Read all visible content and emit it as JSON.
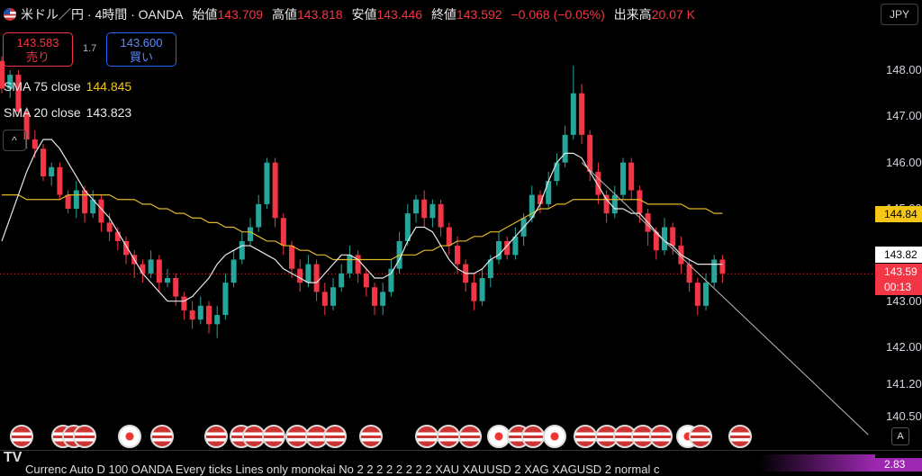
{
  "header": {
    "symbol": "米ドル／円 · 4時間 · OANDA",
    "open_label": "始値",
    "open": "143.709",
    "high_label": "高値",
    "high": "143.818",
    "low_label": "安値",
    "low": "143.446",
    "close_label": "終値",
    "close": "143.592",
    "change": "−0.068 (−0.05%)",
    "volume_label": "出来高",
    "volume": "20.07 K"
  },
  "trade": {
    "sell_price": "143.583",
    "sell_label": "売り",
    "spread": "1.7",
    "buy_price": "143.600",
    "buy_label": "買い"
  },
  "indicators": {
    "sma75_label": "SMA 75 close",
    "sma75_value": "144.845",
    "sma20_label": "SMA 20 close",
    "sma20_value": "143.823"
  },
  "currency_button": "JPY",
  "y_axis": {
    "ticks": [
      "148.00",
      "147.00",
      "146.00",
      "145.00",
      "144.00",
      "143.00",
      "142.00",
      "141.20",
      "140.50"
    ],
    "tag_sma75": "144.84",
    "tag_sma20": "143.82",
    "tag_price": "143.59",
    "tag_timer": "00:13",
    "tag_bottom": "2.83"
  },
  "bottom_bar": {
    "logo": "TV",
    "ticker_text": "Currenc     Auto D 100 OANDA Every ticks Lines only monokai No 2 2 2 2 2 2 2 2 XAU XAUUSD 2 XAG XAGUSD 2 normal c",
    "auto_button": "A"
  },
  "colors": {
    "up": "#26a69a",
    "down": "#f23645",
    "sma75": "#e0b726",
    "sma20": "#e8e8e8",
    "price_line": "#f23645"
  },
  "chart_data": {
    "type": "candlestick",
    "ylim": [
      140.5,
      148.3
    ],
    "candles": [
      [
        148.2,
        147.6,
        148.3,
        147.5
      ],
      [
        147.6,
        147.9,
        148.0,
        147.4
      ],
      [
        147.9,
        147.1,
        148.0,
        147.0
      ],
      [
        147.1,
        146.5,
        147.2,
        146.3
      ],
      [
        146.5,
        146.3,
        146.7,
        146.1
      ],
      [
        146.3,
        145.7,
        146.4,
        145.6
      ],
      [
        145.7,
        145.9,
        146.0,
        145.5
      ],
      [
        145.9,
        145.3,
        146.0,
        145.2
      ],
      [
        145.3,
        145.0,
        145.4,
        144.9
      ],
      [
        145.0,
        145.4,
        145.6,
        144.8
      ],
      [
        145.4,
        144.9,
        145.5,
        144.7
      ],
      [
        144.9,
        145.2,
        145.4,
        144.8
      ],
      [
        145.2,
        144.7,
        145.3,
        144.5
      ],
      [
        144.7,
        144.5,
        144.9,
        144.3
      ],
      [
        144.5,
        144.3,
        144.6,
        144.1
      ],
      [
        144.3,
        144.0,
        144.4,
        143.8
      ],
      [
        144.0,
        143.8,
        144.1,
        143.5
      ],
      [
        143.8,
        143.6,
        143.9,
        143.4
      ],
      [
        143.6,
        143.9,
        144.1,
        143.5
      ],
      [
        143.9,
        143.4,
        144.0,
        143.2
      ],
      [
        143.4,
        143.5,
        143.7,
        143.3
      ],
      [
        143.5,
        143.1,
        143.6,
        142.9
      ],
      [
        143.1,
        142.8,
        143.2,
        142.6
      ],
      [
        142.8,
        142.6,
        143.0,
        142.4
      ],
      [
        142.6,
        142.9,
        143.1,
        142.5
      ],
      [
        142.9,
        142.5,
        143.0,
        142.3
      ],
      [
        142.5,
        142.7,
        142.9,
        142.2
      ],
      [
        142.7,
        143.4,
        143.6,
        142.6
      ],
      [
        143.4,
        143.9,
        144.1,
        143.3
      ],
      [
        143.9,
        144.3,
        144.5,
        143.8
      ],
      [
        144.3,
        144.6,
        144.8,
        144.2
      ],
      [
        144.6,
        145.1,
        145.3,
        144.5
      ],
      [
        145.1,
        146.0,
        146.1,
        145.0
      ],
      [
        146.0,
        144.8,
        146.1,
        144.6
      ],
      [
        144.8,
        144.2,
        144.9,
        144.0
      ],
      [
        144.2,
        143.7,
        144.3,
        143.5
      ],
      [
        143.7,
        143.4,
        143.9,
        143.2
      ],
      [
        143.4,
        143.8,
        144.0,
        143.3
      ],
      [
        143.8,
        143.2,
        143.9,
        143.0
      ],
      [
        143.2,
        142.9,
        143.4,
        142.7
      ],
      [
        142.9,
        143.3,
        143.5,
        142.8
      ],
      [
        143.3,
        143.6,
        143.8,
        143.2
      ],
      [
        143.6,
        144.0,
        144.2,
        143.5
      ],
      [
        144.0,
        143.6,
        144.1,
        143.4
      ],
      [
        143.6,
        143.3,
        143.7,
        143.1
      ],
      [
        143.3,
        142.9,
        143.4,
        142.7
      ],
      [
        142.9,
        143.2,
        143.4,
        142.7
      ],
      [
        143.2,
        143.7,
        143.9,
        143.1
      ],
      [
        143.7,
        144.3,
        144.5,
        143.6
      ],
      [
        144.3,
        144.9,
        145.1,
        144.2
      ],
      [
        144.9,
        145.2,
        145.3,
        144.7
      ],
      [
        145.2,
        144.8,
        145.4,
        144.6
      ],
      [
        144.8,
        145.1,
        145.2,
        144.6
      ],
      [
        145.1,
        144.6,
        145.2,
        144.4
      ],
      [
        144.6,
        144.2,
        144.7,
        144.0
      ],
      [
        144.2,
        143.8,
        144.4,
        143.6
      ],
      [
        143.8,
        143.4,
        143.9,
        143.2
      ],
      [
        143.4,
        143.0,
        143.6,
        142.8
      ],
      [
        143.0,
        143.5,
        143.7,
        142.9
      ],
      [
        143.5,
        143.9,
        144.0,
        143.3
      ],
      [
        143.9,
        144.3,
        144.5,
        143.8
      ],
      [
        144.3,
        144.0,
        144.4,
        143.9
      ],
      [
        144.0,
        144.4,
        144.6,
        143.9
      ],
      [
        144.4,
        144.8,
        144.9,
        144.2
      ],
      [
        144.8,
        145.3,
        145.5,
        144.7
      ],
      [
        145.3,
        145.1,
        145.4,
        144.9
      ],
      [
        145.1,
        145.6,
        145.8,
        145.0
      ],
      [
        145.6,
        146.0,
        146.2,
        145.5
      ],
      [
        146.0,
        146.6,
        146.8,
        145.9
      ],
      [
        146.6,
        147.5,
        148.1,
        146.5
      ],
      [
        147.5,
        146.6,
        147.7,
        146.4
      ],
      [
        146.6,
        145.8,
        146.7,
        145.6
      ],
      [
        145.8,
        145.3,
        146.0,
        145.1
      ],
      [
        145.3,
        144.9,
        145.4,
        144.7
      ],
      [
        144.9,
        145.3,
        145.5,
        144.8
      ],
      [
        145.3,
        146.0,
        146.1,
        145.2
      ],
      [
        146.0,
        145.4,
        146.1,
        145.2
      ],
      [
        145.4,
        144.9,
        145.5,
        144.7
      ],
      [
        144.9,
        144.5,
        145.0,
        144.2
      ],
      [
        144.5,
        144.1,
        144.6,
        143.9
      ],
      [
        144.1,
        144.6,
        144.8,
        144.0
      ],
      [
        144.6,
        144.2,
        144.7,
        144.0
      ],
      [
        144.2,
        143.8,
        144.4,
        143.6
      ],
      [
        143.8,
        143.4,
        143.9,
        143.2
      ],
      [
        143.4,
        142.9,
        143.5,
        142.7
      ],
      [
        142.9,
        143.4,
        143.6,
        142.8
      ],
      [
        143.4,
        143.9,
        144.0,
        143.3
      ],
      [
        143.9,
        143.6,
        144.0,
        143.4
      ]
    ],
    "sma75": [
      145.3,
      145.3,
      145.3,
      145.2,
      145.2,
      145.2,
      145.2,
      145.2,
      145.3,
      145.3,
      145.3,
      145.3,
      145.3,
      145.3,
      145.2,
      145.2,
      145.2,
      145.1,
      145.1,
      145.0,
      145.0,
      144.9,
      144.9,
      144.8,
      144.8,
      144.7,
      144.7,
      144.6,
      144.6,
      144.5,
      144.5,
      144.4,
      144.3,
      144.3,
      144.2,
      144.2,
      144.1,
      144.1,
      144.0,
      144.0,
      143.9,
      143.9,
      143.9,
      143.9,
      143.9,
      143.9,
      143.9,
      143.9,
      144.0,
      144.0,
      144.0,
      144.1,
      144.1,
      144.2,
      144.2,
      144.3,
      144.3,
      144.4,
      144.4,
      144.5,
      144.5,
      144.6,
      144.7,
      144.8,
      144.9,
      145.0,
      145.0,
      145.1,
      145.1,
      145.2,
      145.2,
      145.2,
      145.2,
      145.2,
      145.2,
      145.2,
      145.2,
      145.2,
      145.1,
      145.1,
      145.1,
      145.1,
      145.1,
      145.0,
      145.0,
      145.0,
      144.9,
      144.9
    ],
    "sma20": [
      144.3,
      144.8,
      145.3,
      145.8,
      146.2,
      146.5,
      146.5,
      146.3,
      146.0,
      145.7,
      145.4,
      145.2,
      145.0,
      144.8,
      144.5,
      144.2,
      143.9,
      143.6,
      143.4,
      143.2,
      143.0,
      143.0,
      143.0,
      143.1,
      143.3,
      143.5,
      143.8,
      144.0,
      144.1,
      144.2,
      144.2,
      144.1,
      144.0,
      143.9,
      143.7,
      143.6,
      143.5,
      143.4,
      143.4,
      143.6,
      143.8,
      144.0,
      144.0,
      143.9,
      143.7,
      143.5,
      143.5,
      143.6,
      143.9,
      144.3,
      144.6,
      144.6,
      144.5,
      144.2,
      143.9,
      143.7,
      143.6,
      143.6,
      143.7,
      143.9,
      144.0,
      144.2,
      144.4,
      144.6,
      144.8,
      145.1,
      145.6,
      146.0,
      146.2,
      146.2,
      146.1,
      145.8,
      145.5,
      145.2,
      145.0,
      145.0,
      144.9,
      144.9,
      144.7,
      144.5,
      144.3,
      144.2,
      144.0,
      143.9,
      143.8,
      143.8,
      143.8,
      143.8
    ],
    "trendline": {
      "from": [
        70,
        146.0
      ],
      "to": [
        97,
        140.3
      ]
    },
    "current_price": 143.592
  }
}
